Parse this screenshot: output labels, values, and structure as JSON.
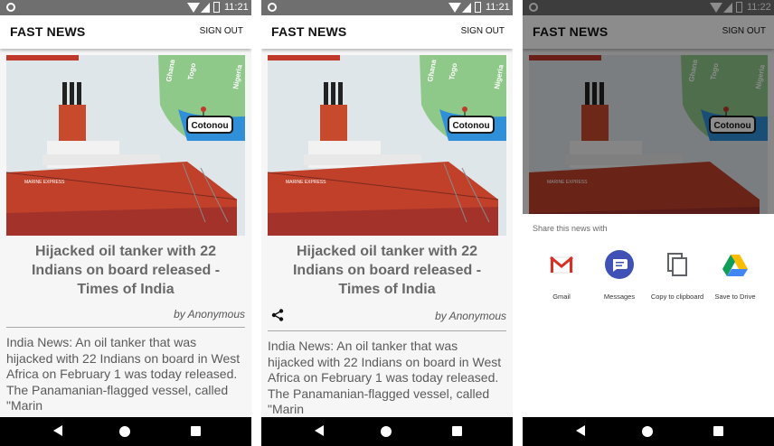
{
  "status": {
    "time_1": "11:21",
    "time_2": "11:21",
    "time_3": "11:22"
  },
  "appbar": {
    "title": "FAST NEWS",
    "signout_label": "SIGN OUT"
  },
  "article": {
    "headline": "Hijacked oil tanker with 22 Indians on board released - Times of India",
    "byline": "by Anonymous",
    "body": "India News: An oil tanker that was hijacked with 22 Indians on board in West Africa on February 1 was today released. The Panamanian-flagged vessel, called \"Marin",
    "image": {
      "map_label_city": "Cotonou",
      "map_label_country_1": "Ghana",
      "map_label_country_2": "Togo",
      "map_label_country_3": "Nigeria",
      "ship_name": "MARINE EXPRESS"
    }
  },
  "share_sheet": {
    "title": "Share this news with",
    "targets": [
      {
        "label": "Gmail",
        "icon": "gmail-icon"
      },
      {
        "label": "Messages",
        "icon": "messages-icon"
      },
      {
        "label": "Copy to clipboard",
        "icon": "copy-icon"
      },
      {
        "label": "Save to Drive",
        "icon": "drive-icon"
      }
    ]
  },
  "colors": {
    "status_bar": "#6f6f6f",
    "nav_bar": "#000000",
    "headline": "#686868",
    "hull_red": "#c0402a",
    "map_blue": "#2f8fd8",
    "messages_blue": "#3f51b5"
  }
}
